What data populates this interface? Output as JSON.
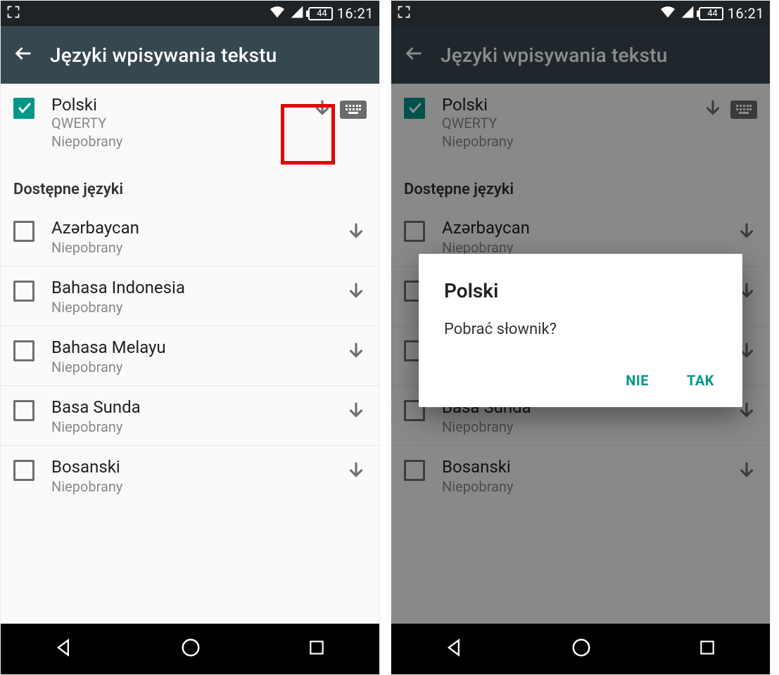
{
  "status": {
    "battery": "44",
    "time": "16:21"
  },
  "appbar": {
    "title": "Języki wpisywania tekstu"
  },
  "selected": {
    "name": "Polski",
    "layout": "QWERTY",
    "status": "Niepobrany"
  },
  "section_header": "Dostępne języki",
  "languages": [
    {
      "name": "Azərbaycan",
      "status": "Niepobrany"
    },
    {
      "name": "Bahasa Indonesia",
      "status": "Niepobrany"
    },
    {
      "name": "Bahasa Melayu",
      "status": "Niepobrany"
    },
    {
      "name": "Basa Sunda",
      "status": "Niepobrany"
    },
    {
      "name": "Bosanski",
      "status": "Niepobrany"
    }
  ],
  "dialog": {
    "title": "Polski",
    "message": "Pobrać słownik?",
    "negative": "NIE",
    "positive": "TAK"
  }
}
